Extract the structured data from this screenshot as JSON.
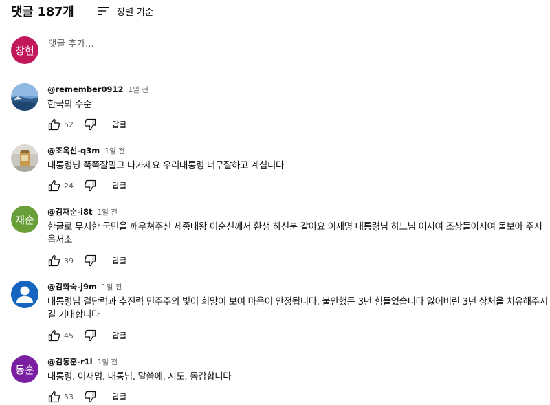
{
  "header": {
    "comment_count": "댓글 187개",
    "sort_label": "정렬 기준"
  },
  "add_comment": {
    "avatar_text": "창헌",
    "avatar_color": "#c2185b",
    "placeholder": "댓글 추가..."
  },
  "comments": [
    {
      "author": "@remember0912",
      "time": "1일 전",
      "text": "한국의 수준",
      "likes": "52",
      "reply_label": "답글",
      "avatar_type": "photo-landscape"
    },
    {
      "author": "@조옥선-q3m",
      "time": "1일 전",
      "text": "대통령닝 쭉쭉잘밀고 나가세요 우리대통령 너무잘하고 계십니다",
      "likes": "24",
      "reply_label": "답글",
      "avatar_type": "photo-object"
    },
    {
      "author": "@김재순-i8t",
      "time": "1일 전",
      "text": "한글로 무지한 국민을 깨우쳐주신 세종대왕 이순신께서 환생 하신분 같아요 이재명 대통령님 하느님 이시여 조상들이시여 돌보아 주시옵서소",
      "likes": "39",
      "reply_label": "답글",
      "avatar_text": "재순",
      "avatar_color": "#689f38"
    },
    {
      "author": "@김화숙-j9m",
      "time": "1일 전",
      "text": "대통령님 결단력과 추진력 민주주의 빛이 희망이 보여 마음이 안정됩니다. 불안했든 3년 힘들었습니다 잃어버린 3년 상처을 치유해주시길 기대합니다",
      "likes": "45",
      "reply_label": "답글",
      "avatar_type": "default-person",
      "avatar_color": "#1565c0"
    },
    {
      "author": "@김동훈-r1l",
      "time": "1일 전",
      "text": "대통령. 이재명. 대통님. 말씀에. 저도. 동감합니다",
      "likes": "53",
      "reply_label": "답글",
      "avatar_text": "동훈",
      "avatar_color": "#7b1fa2"
    }
  ],
  "icons": {
    "sort": "sort-icon",
    "like": "thumb-up-icon",
    "dislike": "thumb-down-icon"
  }
}
